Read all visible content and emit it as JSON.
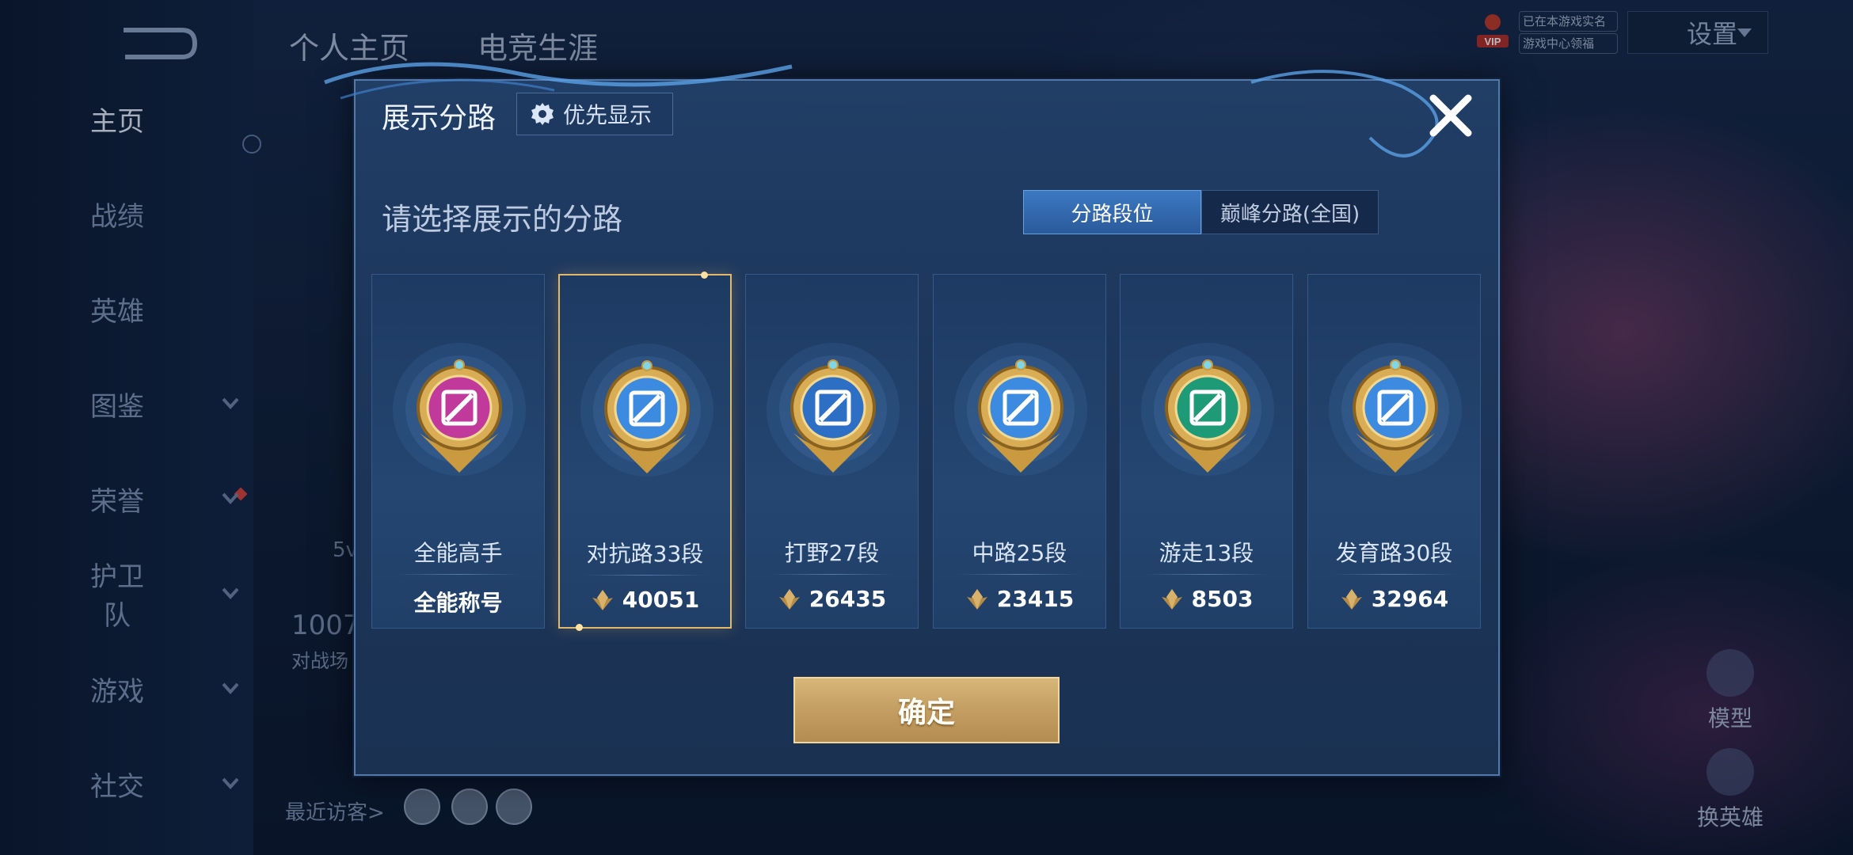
{
  "background": {
    "tabs": [
      "个人主页",
      "电竞生涯"
    ],
    "nav": [
      {
        "label": "主页",
        "active": true
      },
      {
        "label": "战绩"
      },
      {
        "label": "英雄"
      },
      {
        "label": "图鉴",
        "expand": true
      },
      {
        "label": "荣誉",
        "expand": true
      },
      {
        "label": "护卫队",
        "expand": true
      },
      {
        "label": "游戏",
        "expand": true
      },
      {
        "label": "社交",
        "expand": true
      }
    ],
    "settings_label": "设置",
    "status_lines": [
      "已在本游戏实名",
      "游戏中心领福"
    ],
    "left_stat_value": "1007",
    "left_stat_label": "对战场",
    "left_mode": "5v",
    "visitors_label": "最近访客>",
    "right_buttons": [
      "模型",
      "换英雄"
    ]
  },
  "modal": {
    "title": "展示分路",
    "priority_label": "优先显示",
    "subtitle": "请选择展示的分路",
    "segments": [
      {
        "label": "分路段位",
        "active": true
      },
      {
        "label": "巅峰分路(全国)",
        "active": false
      }
    ],
    "cards": [
      {
        "name": "全能高手",
        "value": "全能称号",
        "has_icon": false,
        "color": "#c0399b",
        "icon": "rune-icon"
      },
      {
        "name": "对抗路33段",
        "value": "40051",
        "has_icon": true,
        "color": "#3d8be0",
        "icon": "crossed-swords-icon",
        "selected": true
      },
      {
        "name": "打野27段",
        "value": "26435",
        "has_icon": true,
        "color": "#2d6fc4",
        "icon": "dragon-icon"
      },
      {
        "name": "中路25段",
        "value": "23415",
        "has_icon": true,
        "color": "#3d8be0",
        "icon": "staff-icon"
      },
      {
        "name": "游走13段",
        "value": "8503",
        "has_icon": true,
        "color": "#1f9a77",
        "icon": "wings-icon"
      },
      {
        "name": "发育路30段",
        "value": "32964",
        "has_icon": true,
        "color": "#3d8be0",
        "icon": "target-icon"
      }
    ],
    "confirm_label": "确定"
  }
}
